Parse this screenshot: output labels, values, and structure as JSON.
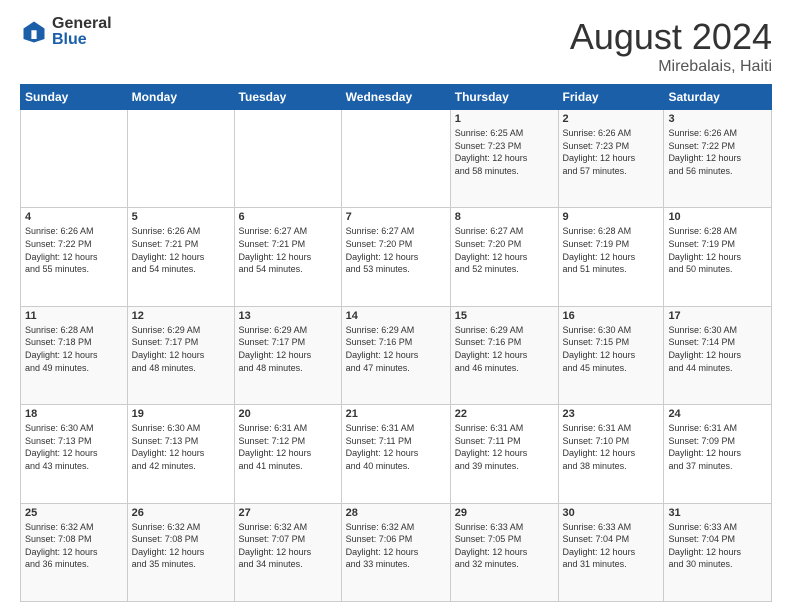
{
  "logo": {
    "general": "General",
    "blue": "Blue"
  },
  "title": "August 2024",
  "subtitle": "Mirebalais, Haiti",
  "days_of_week": [
    "Sunday",
    "Monday",
    "Tuesday",
    "Wednesday",
    "Thursday",
    "Friday",
    "Saturday"
  ],
  "weeks": [
    [
      {
        "day": "",
        "info": ""
      },
      {
        "day": "",
        "info": ""
      },
      {
        "day": "",
        "info": ""
      },
      {
        "day": "",
        "info": ""
      },
      {
        "day": "1",
        "info": "Sunrise: 6:25 AM\nSunset: 7:23 PM\nDaylight: 12 hours\nand 58 minutes."
      },
      {
        "day": "2",
        "info": "Sunrise: 6:26 AM\nSunset: 7:23 PM\nDaylight: 12 hours\nand 57 minutes."
      },
      {
        "day": "3",
        "info": "Sunrise: 6:26 AM\nSunset: 7:22 PM\nDaylight: 12 hours\nand 56 minutes."
      }
    ],
    [
      {
        "day": "4",
        "info": "Sunrise: 6:26 AM\nSunset: 7:22 PM\nDaylight: 12 hours\nand 55 minutes."
      },
      {
        "day": "5",
        "info": "Sunrise: 6:26 AM\nSunset: 7:21 PM\nDaylight: 12 hours\nand 54 minutes."
      },
      {
        "day": "6",
        "info": "Sunrise: 6:27 AM\nSunset: 7:21 PM\nDaylight: 12 hours\nand 54 minutes."
      },
      {
        "day": "7",
        "info": "Sunrise: 6:27 AM\nSunset: 7:20 PM\nDaylight: 12 hours\nand 53 minutes."
      },
      {
        "day": "8",
        "info": "Sunrise: 6:27 AM\nSunset: 7:20 PM\nDaylight: 12 hours\nand 52 minutes."
      },
      {
        "day": "9",
        "info": "Sunrise: 6:28 AM\nSunset: 7:19 PM\nDaylight: 12 hours\nand 51 minutes."
      },
      {
        "day": "10",
        "info": "Sunrise: 6:28 AM\nSunset: 7:19 PM\nDaylight: 12 hours\nand 50 minutes."
      }
    ],
    [
      {
        "day": "11",
        "info": "Sunrise: 6:28 AM\nSunset: 7:18 PM\nDaylight: 12 hours\nand 49 minutes."
      },
      {
        "day": "12",
        "info": "Sunrise: 6:29 AM\nSunset: 7:17 PM\nDaylight: 12 hours\nand 48 minutes."
      },
      {
        "day": "13",
        "info": "Sunrise: 6:29 AM\nSunset: 7:17 PM\nDaylight: 12 hours\nand 48 minutes."
      },
      {
        "day": "14",
        "info": "Sunrise: 6:29 AM\nSunset: 7:16 PM\nDaylight: 12 hours\nand 47 minutes."
      },
      {
        "day": "15",
        "info": "Sunrise: 6:29 AM\nSunset: 7:16 PM\nDaylight: 12 hours\nand 46 minutes."
      },
      {
        "day": "16",
        "info": "Sunrise: 6:30 AM\nSunset: 7:15 PM\nDaylight: 12 hours\nand 45 minutes."
      },
      {
        "day": "17",
        "info": "Sunrise: 6:30 AM\nSunset: 7:14 PM\nDaylight: 12 hours\nand 44 minutes."
      }
    ],
    [
      {
        "day": "18",
        "info": "Sunrise: 6:30 AM\nSunset: 7:13 PM\nDaylight: 12 hours\nand 43 minutes."
      },
      {
        "day": "19",
        "info": "Sunrise: 6:30 AM\nSunset: 7:13 PM\nDaylight: 12 hours\nand 42 minutes."
      },
      {
        "day": "20",
        "info": "Sunrise: 6:31 AM\nSunset: 7:12 PM\nDaylight: 12 hours\nand 41 minutes."
      },
      {
        "day": "21",
        "info": "Sunrise: 6:31 AM\nSunset: 7:11 PM\nDaylight: 12 hours\nand 40 minutes."
      },
      {
        "day": "22",
        "info": "Sunrise: 6:31 AM\nSunset: 7:11 PM\nDaylight: 12 hours\nand 39 minutes."
      },
      {
        "day": "23",
        "info": "Sunrise: 6:31 AM\nSunset: 7:10 PM\nDaylight: 12 hours\nand 38 minutes."
      },
      {
        "day": "24",
        "info": "Sunrise: 6:31 AM\nSunset: 7:09 PM\nDaylight: 12 hours\nand 37 minutes."
      }
    ],
    [
      {
        "day": "25",
        "info": "Sunrise: 6:32 AM\nSunset: 7:08 PM\nDaylight: 12 hours\nand 36 minutes."
      },
      {
        "day": "26",
        "info": "Sunrise: 6:32 AM\nSunset: 7:08 PM\nDaylight: 12 hours\nand 35 minutes."
      },
      {
        "day": "27",
        "info": "Sunrise: 6:32 AM\nSunset: 7:07 PM\nDaylight: 12 hours\nand 34 minutes."
      },
      {
        "day": "28",
        "info": "Sunrise: 6:32 AM\nSunset: 7:06 PM\nDaylight: 12 hours\nand 33 minutes."
      },
      {
        "day": "29",
        "info": "Sunrise: 6:33 AM\nSunset: 7:05 PM\nDaylight: 12 hours\nand 32 minutes."
      },
      {
        "day": "30",
        "info": "Sunrise: 6:33 AM\nSunset: 7:04 PM\nDaylight: 12 hours\nand 31 minutes."
      },
      {
        "day": "31",
        "info": "Sunrise: 6:33 AM\nSunset: 7:04 PM\nDaylight: 12 hours\nand 30 minutes."
      }
    ]
  ]
}
